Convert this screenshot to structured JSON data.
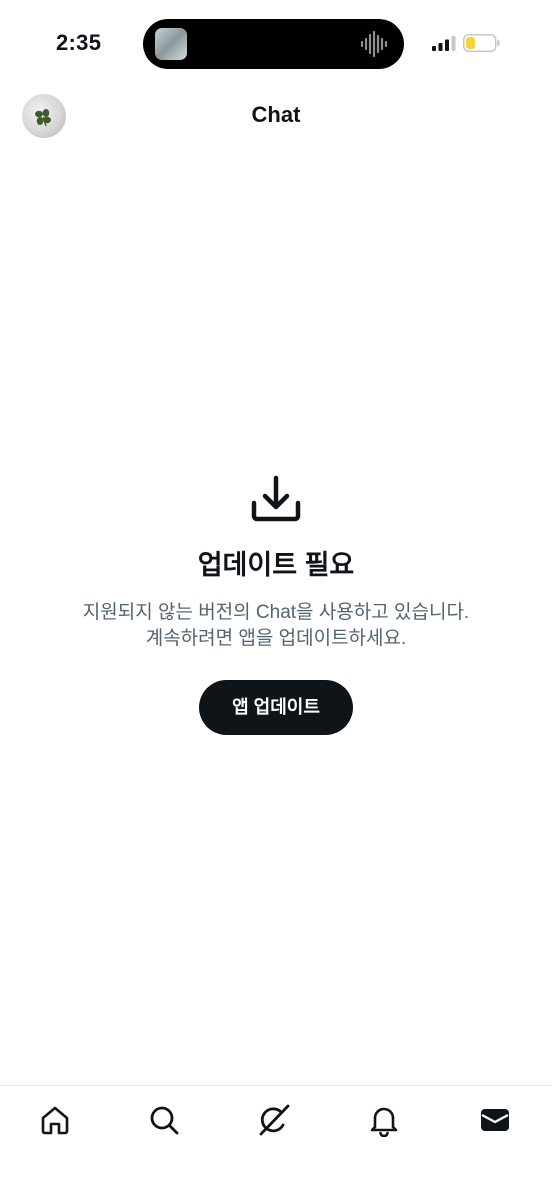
{
  "status_bar": {
    "time": "2:35",
    "battery_color": "#f5d33b"
  },
  "header": {
    "title": "Chat"
  },
  "content": {
    "icon": "download-icon",
    "heading": "업데이트 필요",
    "message_line1": "지원되지 않는 버전의 Chat을 사용하고 있습니다.",
    "message_line2": "계속하려면 앱을 업데이트하세요.",
    "button_label": "앱 업데이트"
  },
  "bottom_nav": {
    "items": [
      {
        "icon": "home-icon"
      },
      {
        "icon": "search-icon"
      },
      {
        "icon": "grok-icon"
      },
      {
        "icon": "bell-icon"
      },
      {
        "icon": "mail-icon",
        "active": true
      }
    ]
  },
  "colors": {
    "text": "#0f1419",
    "secondary_text": "#536471",
    "button_bg": "#0f1419",
    "button_text": "#ffffff"
  }
}
